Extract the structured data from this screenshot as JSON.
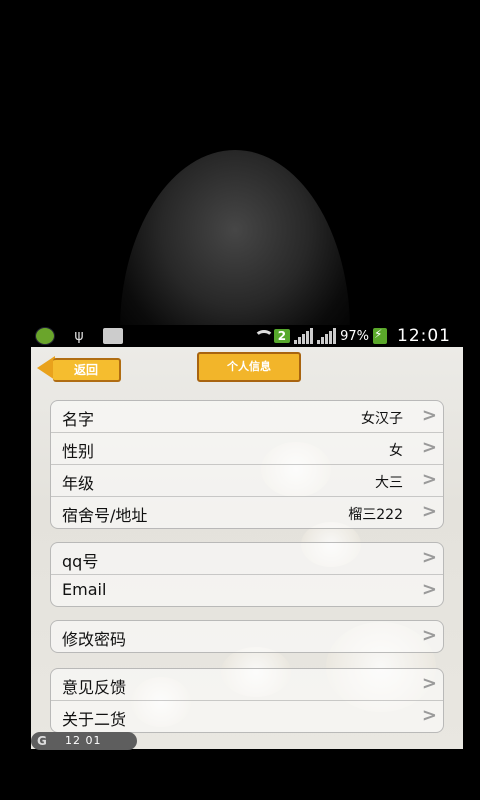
{
  "status_bar": {
    "battery_percent": "97%",
    "sim_badge": "2",
    "time": "12:01"
  },
  "header": {
    "back_label": "返回",
    "title_label": "个人信息"
  },
  "groups": [
    {
      "rows": [
        {
          "label": "名字",
          "value": "女汉子"
        },
        {
          "label": "性别",
          "value": "女"
        },
        {
          "label": "年级",
          "value": "大三"
        },
        {
          "label": "宿舍号/地址",
          "value": "榴三222"
        }
      ]
    },
    {
      "rows": [
        {
          "label": "qq号",
          "value": ""
        },
        {
          "label": "Email",
          "value": ""
        }
      ]
    },
    {
      "rows": [
        {
          "label": "修改密码",
          "value": ""
        }
      ]
    },
    {
      "rows": [
        {
          "label": "意见反馈",
          "value": ""
        },
        {
          "label": "关于二货",
          "value": ""
        }
      ]
    }
  ],
  "chevron": ">",
  "bottom_clock": "12 01",
  "bottom_logo": "G",
  "colors": {
    "sign_yellow": "#f2b52a",
    "sign_border": "#a86410",
    "battery_green": "#5aa82a"
  }
}
